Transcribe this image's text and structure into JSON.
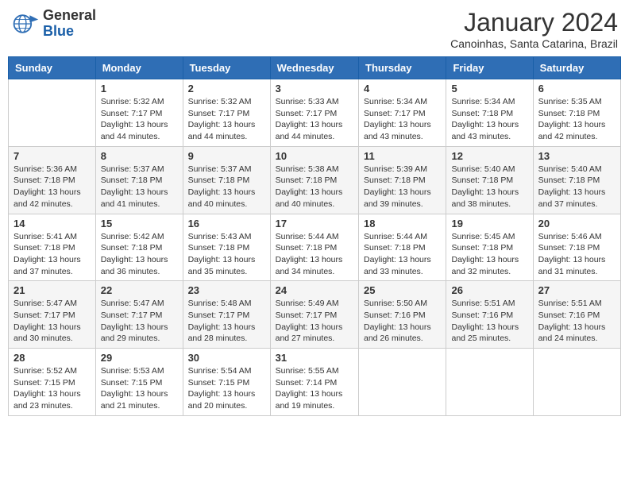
{
  "header": {
    "logo_line1": "General",
    "logo_line2": "Blue",
    "month_title": "January 2024",
    "subtitle": "Canoinhas, Santa Catarina, Brazil"
  },
  "weekdays": [
    "Sunday",
    "Monday",
    "Tuesday",
    "Wednesday",
    "Thursday",
    "Friday",
    "Saturday"
  ],
  "weeks": [
    [
      {
        "day": "",
        "info": ""
      },
      {
        "day": "1",
        "info": "Sunrise: 5:32 AM\nSunset: 7:17 PM\nDaylight: 13 hours and 44 minutes."
      },
      {
        "day": "2",
        "info": "Sunrise: 5:32 AM\nSunset: 7:17 PM\nDaylight: 13 hours and 44 minutes."
      },
      {
        "day": "3",
        "info": "Sunrise: 5:33 AM\nSunset: 7:17 PM\nDaylight: 13 hours and 44 minutes."
      },
      {
        "day": "4",
        "info": "Sunrise: 5:34 AM\nSunset: 7:17 PM\nDaylight: 13 hours and 43 minutes."
      },
      {
        "day": "5",
        "info": "Sunrise: 5:34 AM\nSunset: 7:18 PM\nDaylight: 13 hours and 43 minutes."
      },
      {
        "day": "6",
        "info": "Sunrise: 5:35 AM\nSunset: 7:18 PM\nDaylight: 13 hours and 42 minutes."
      }
    ],
    [
      {
        "day": "7",
        "info": "Sunrise: 5:36 AM\nSunset: 7:18 PM\nDaylight: 13 hours and 42 minutes."
      },
      {
        "day": "8",
        "info": "Sunrise: 5:37 AM\nSunset: 7:18 PM\nDaylight: 13 hours and 41 minutes."
      },
      {
        "day": "9",
        "info": "Sunrise: 5:37 AM\nSunset: 7:18 PM\nDaylight: 13 hours and 40 minutes."
      },
      {
        "day": "10",
        "info": "Sunrise: 5:38 AM\nSunset: 7:18 PM\nDaylight: 13 hours and 40 minutes."
      },
      {
        "day": "11",
        "info": "Sunrise: 5:39 AM\nSunset: 7:18 PM\nDaylight: 13 hours and 39 minutes."
      },
      {
        "day": "12",
        "info": "Sunrise: 5:40 AM\nSunset: 7:18 PM\nDaylight: 13 hours and 38 minutes."
      },
      {
        "day": "13",
        "info": "Sunrise: 5:40 AM\nSunset: 7:18 PM\nDaylight: 13 hours and 37 minutes."
      }
    ],
    [
      {
        "day": "14",
        "info": "Sunrise: 5:41 AM\nSunset: 7:18 PM\nDaylight: 13 hours and 37 minutes."
      },
      {
        "day": "15",
        "info": "Sunrise: 5:42 AM\nSunset: 7:18 PM\nDaylight: 13 hours and 36 minutes."
      },
      {
        "day": "16",
        "info": "Sunrise: 5:43 AM\nSunset: 7:18 PM\nDaylight: 13 hours and 35 minutes."
      },
      {
        "day": "17",
        "info": "Sunrise: 5:44 AM\nSunset: 7:18 PM\nDaylight: 13 hours and 34 minutes."
      },
      {
        "day": "18",
        "info": "Sunrise: 5:44 AM\nSunset: 7:18 PM\nDaylight: 13 hours and 33 minutes."
      },
      {
        "day": "19",
        "info": "Sunrise: 5:45 AM\nSunset: 7:18 PM\nDaylight: 13 hours and 32 minutes."
      },
      {
        "day": "20",
        "info": "Sunrise: 5:46 AM\nSunset: 7:18 PM\nDaylight: 13 hours and 31 minutes."
      }
    ],
    [
      {
        "day": "21",
        "info": "Sunrise: 5:47 AM\nSunset: 7:17 PM\nDaylight: 13 hours and 30 minutes."
      },
      {
        "day": "22",
        "info": "Sunrise: 5:47 AM\nSunset: 7:17 PM\nDaylight: 13 hours and 29 minutes."
      },
      {
        "day": "23",
        "info": "Sunrise: 5:48 AM\nSunset: 7:17 PM\nDaylight: 13 hours and 28 minutes."
      },
      {
        "day": "24",
        "info": "Sunrise: 5:49 AM\nSunset: 7:17 PM\nDaylight: 13 hours and 27 minutes."
      },
      {
        "day": "25",
        "info": "Sunrise: 5:50 AM\nSunset: 7:16 PM\nDaylight: 13 hours and 26 minutes."
      },
      {
        "day": "26",
        "info": "Sunrise: 5:51 AM\nSunset: 7:16 PM\nDaylight: 13 hours and 25 minutes."
      },
      {
        "day": "27",
        "info": "Sunrise: 5:51 AM\nSunset: 7:16 PM\nDaylight: 13 hours and 24 minutes."
      }
    ],
    [
      {
        "day": "28",
        "info": "Sunrise: 5:52 AM\nSunset: 7:15 PM\nDaylight: 13 hours and 23 minutes."
      },
      {
        "day": "29",
        "info": "Sunrise: 5:53 AM\nSunset: 7:15 PM\nDaylight: 13 hours and 21 minutes."
      },
      {
        "day": "30",
        "info": "Sunrise: 5:54 AM\nSunset: 7:15 PM\nDaylight: 13 hours and 20 minutes."
      },
      {
        "day": "31",
        "info": "Sunrise: 5:55 AM\nSunset: 7:14 PM\nDaylight: 13 hours and 19 minutes."
      },
      {
        "day": "",
        "info": ""
      },
      {
        "day": "",
        "info": ""
      },
      {
        "day": "",
        "info": ""
      }
    ]
  ]
}
